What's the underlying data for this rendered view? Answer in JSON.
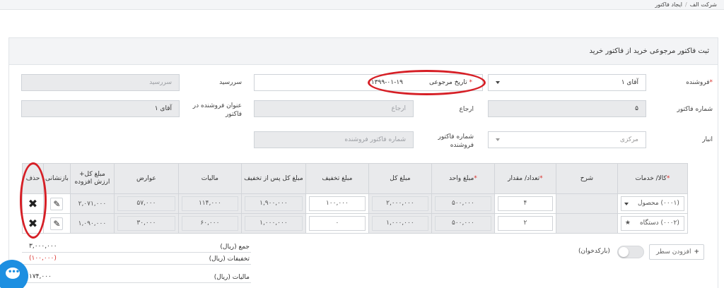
{
  "breadcrumb": {
    "home": "شرکت الف",
    "current": "ایجاد فاکتور"
  },
  "page": {
    "title": "ثبت فاکتور مرجوعی خرید از فاکتور خرید"
  },
  "form": {
    "vendor": {
      "label": "فروشنده",
      "value": "آقای ۱"
    },
    "ref_date": {
      "label": "تاریخ مرجوعی",
      "value": "۱۳۹۹-۰۱-۱۹"
    },
    "due_date": {
      "label": "سررسید",
      "placeholder": "سررسید"
    },
    "invoice_no": {
      "label": "شماره فاکتور",
      "value": "۵"
    },
    "ref": {
      "label": "ارجاع",
      "placeholder": "ارجاع"
    },
    "vendor_title": {
      "label": "عنوان فروشنده در فاکتور",
      "value": "آقای ۱"
    },
    "warehouse": {
      "label": "انبار",
      "value": "مرکزی"
    },
    "vendor_invoice_no": {
      "label": "شماره فاکتور فروشنده",
      "placeholder": "شماره فاکتور فروشنده"
    }
  },
  "table": {
    "headers": {
      "item": "کالا/ خدمات",
      "description": "شرح",
      "qty": "تعداد/ مقدار",
      "unit_price": "مبلغ واحد",
      "total": "مبلغ کل",
      "discount": "مبلغ تخفیف",
      "after_discount": "مبلغ کل پس از تخفیف",
      "tax": "مالیات",
      "duties": "عوارض",
      "total_vat": "مبلغ کل+ ارزش افزوده",
      "review": "بازنشانی",
      "delete": "حذف"
    },
    "rows": [
      {
        "item": "(۰۰۰۱) محصول",
        "description": "",
        "qty": "۴",
        "unit_price": "۵۰۰,۰۰۰",
        "total": "۲,۰۰۰,۰۰۰",
        "discount": "۱۰۰,۰۰۰",
        "after_discount": "۱,۹۰۰,۰۰۰",
        "tax": "۱۱۴,۰۰۰",
        "duties": "۵۷,۰۰۰",
        "total_vat": "۲,۰۷۱,۰۰۰"
      },
      {
        "item": "(۰۰۰۲) دستگاه",
        "description": "",
        "qty": "۲",
        "unit_price": "۵۰۰,۰۰۰",
        "total": "۱,۰۰۰,۰۰۰",
        "discount": "۰",
        "after_discount": "۱,۰۰۰,۰۰۰",
        "tax": "۶۰,۰۰۰",
        "duties": "۳۰,۰۰۰",
        "total_vat": "۱,۰۹۰,۰۰۰"
      }
    ]
  },
  "totals": {
    "sum": {
      "label": "جمع (ریال)",
      "value": "۳,۰۰۰,۰۰۰"
    },
    "discounts": {
      "label": "تخفیفات (ریال)",
      "value": "(۱۰۰,۰۰۰)"
    },
    "tax": {
      "label": "مالیات (ریال)",
      "value": "۱۷۴,۰۰۰"
    }
  },
  "actions": {
    "add_row": "افزودن سطر",
    "barcode": "(بارکدخوان)"
  },
  "colors": {
    "required": "#d9302b",
    "highlight": "#d61f26",
    "chat": "#1d8fe1"
  },
  "icons": {
    "delete": "close-icon",
    "review": "edit-icon",
    "add": "plus-icon",
    "chat": "chat-icon"
  }
}
